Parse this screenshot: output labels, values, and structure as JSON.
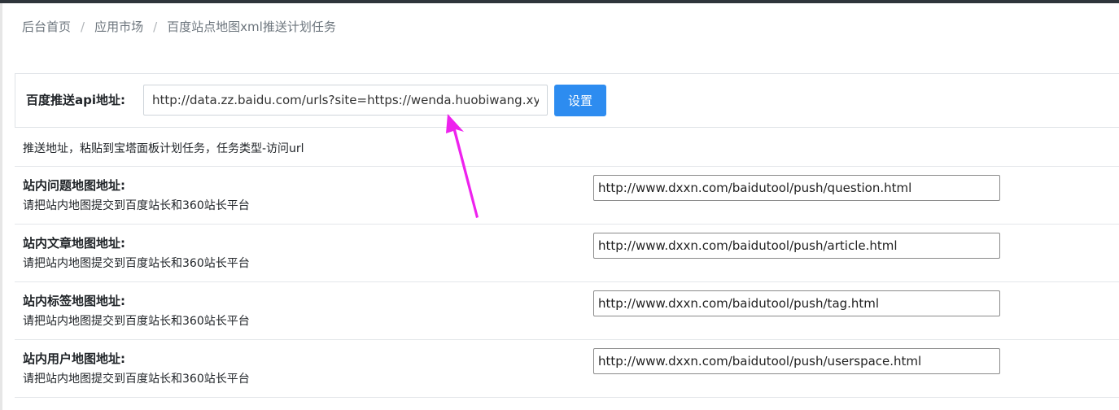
{
  "breadcrumb": {
    "items": [
      "后台首页",
      "应用市场",
      "百度站点地图xml推送计划任务"
    ],
    "separator": "/"
  },
  "api": {
    "label": "百度推送api地址:",
    "value": "http://data.zz.baidu.com/urls?site=https://wenda.huobiwang.xyz&token=",
    "button_label": "设置",
    "button_color": "#2d8cf0"
  },
  "note": "推送地址，粘贴到宝塔面板计划任务，任务类型-访问url",
  "rows": [
    {
      "title": "站内问题地图地址:",
      "desc": "请把站内地图提交到百度站长和360站长平台",
      "url": "http://www.dxxn.com/baidutool/push/question.html"
    },
    {
      "title": "站内文章地图地址:",
      "desc": "请把站内地图提交到百度站长和360站长平台",
      "url": "http://www.dxxn.com/baidutool/push/article.html"
    },
    {
      "title": "站内标签地图地址:",
      "desc": "请把站内地图提交到百度站长和360站长平台",
      "url": "http://www.dxxn.com/baidutool/push/tag.html"
    },
    {
      "title": "站内用户地图地址:",
      "desc": "请把站内地图提交到百度站长和360站长平台",
      "url": "http://www.dxxn.com/baidutool/push/userspace.html"
    }
  ],
  "annotation": {
    "arrow_icon": "arrow-up-icon",
    "color": "#ee22ee"
  }
}
